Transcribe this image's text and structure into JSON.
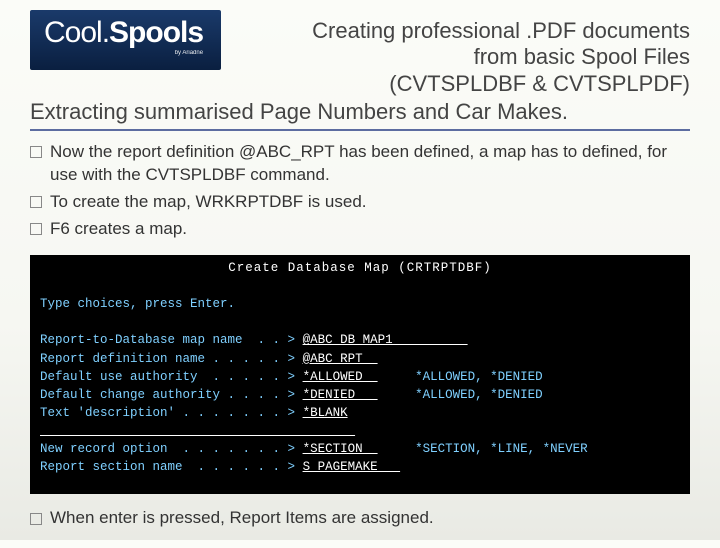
{
  "logo": {
    "text1": "Cool.",
    "text2": "Spools",
    "by": "by Ariadne"
  },
  "heading": {
    "line1": "Creating professional .PDF documents",
    "line2": "from basic Spool Files",
    "line3": "(CVTSPLDBF & CVTSPLPDF)"
  },
  "subtitle": "Extracting summarised Page Numbers and Car Makes.",
  "bullets": [
    "Now the report definition @ABC_RPT has been defined, a map has to defined, for use with the CVTSPLDBF command.",
    "To create the map, WRKRPTDBF is used.",
    "F6 creates a map."
  ],
  "terminal": {
    "title": "Create Database Map (CRTRPTDBF)",
    "prompt": "Type choices, press Enter.",
    "rows": [
      {
        "label": "Report-to-Database map name  . . >",
        "value": "@ABC_DB_MAP1          ",
        "hint": ""
      },
      {
        "label": "Report definition name . . . . . >",
        "value": "@ABC_RPT  ",
        "hint": ""
      },
      {
        "label": "Default use authority  . . . . . >",
        "value": "*ALLOWED  ",
        "hint": "*ALLOWED, *DENIED"
      },
      {
        "label": "Default change authority . . . . >",
        "value": "*DENIED   ",
        "hint": "*ALLOWED, *DENIED"
      },
      {
        "label": "Text 'description' . . . . . . . >",
        "value": "*BLANK",
        "hint": ""
      }
    ],
    "rows2": [
      {
        "label": "New record option  . . . . . . . >",
        "value": "*SECTION  ",
        "hint": "*SECTION, *LINE, *NEVER"
      },
      {
        "label": "Report section name  . . . . . . >",
        "value": "S_PAGEMAKE   ",
        "hint": ""
      }
    ]
  },
  "footer_bullet": "When enter is pressed, Report Items are assigned."
}
